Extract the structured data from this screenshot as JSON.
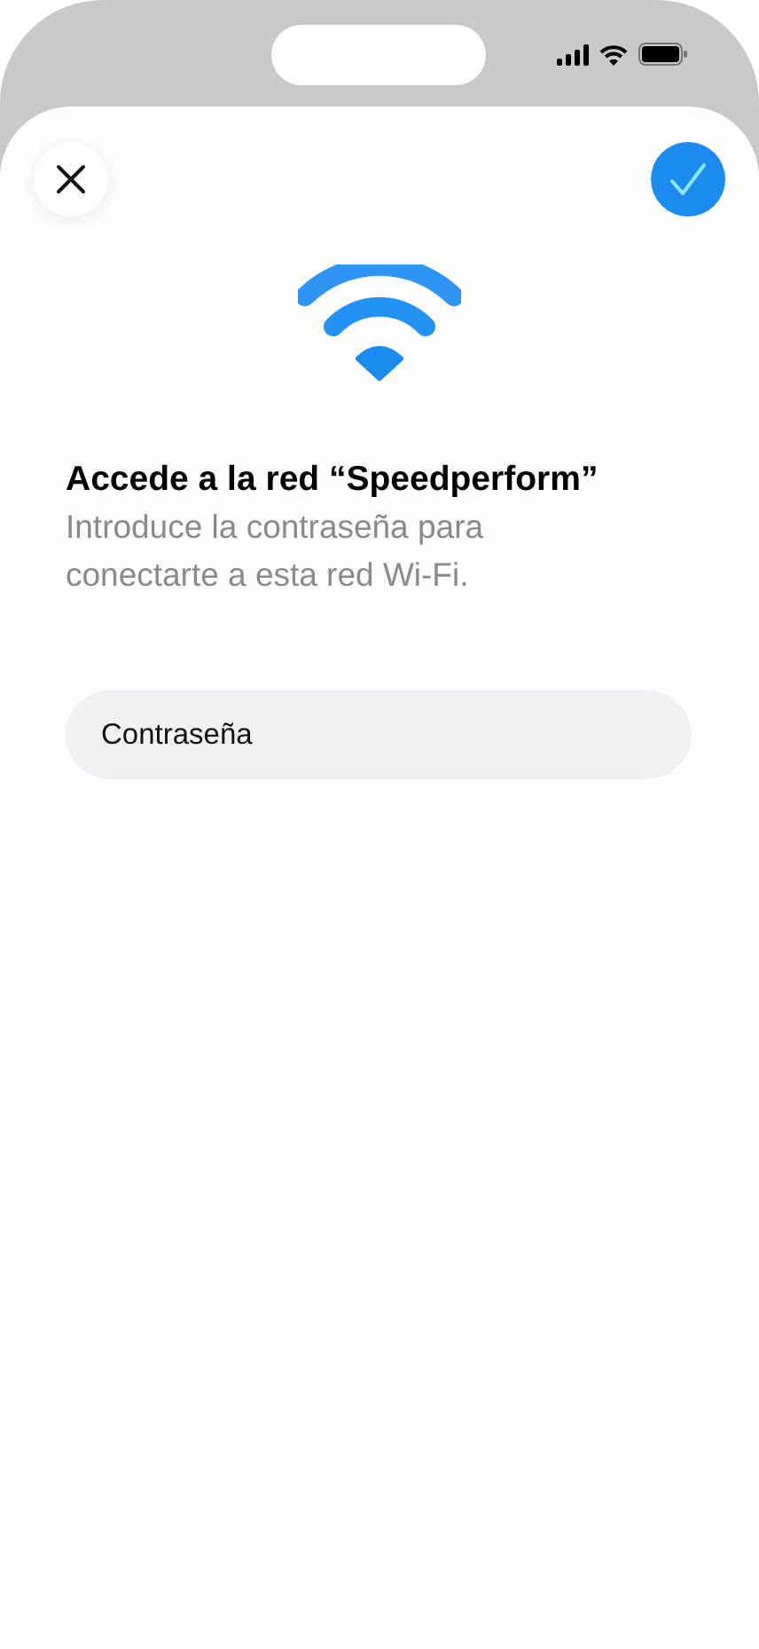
{
  "sheet": {
    "title": "Accede a la red “Speedperform”",
    "subtitle": "Introduce la contraseña para conectarte a esta red Wi-Fi.",
    "password_field": {
      "label": "Contraseña"
    }
  }
}
